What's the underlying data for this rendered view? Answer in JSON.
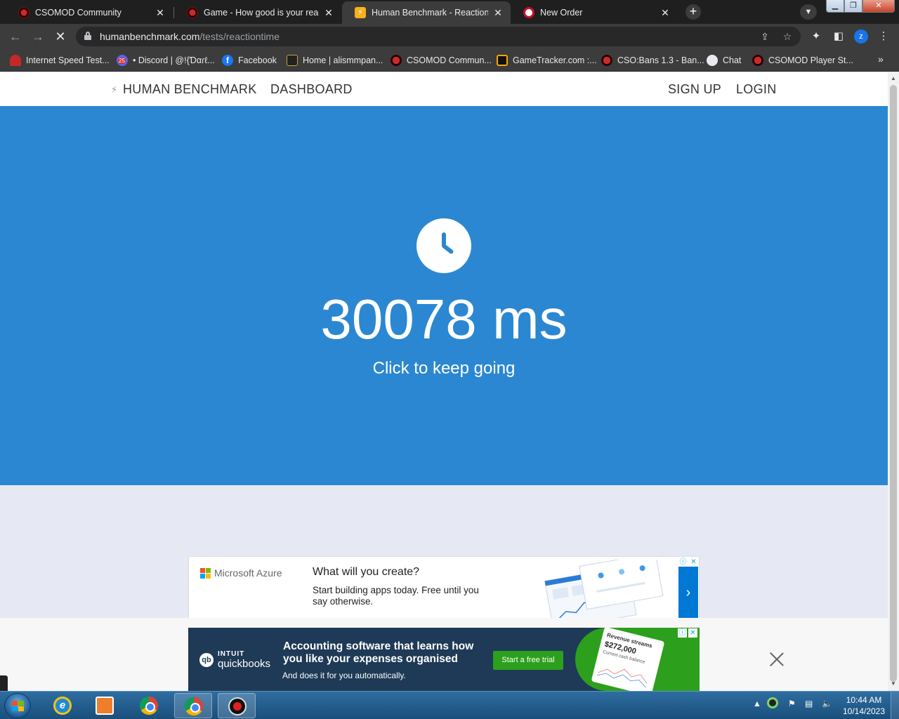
{
  "browser": {
    "tabs": [
      {
        "title": "CSOMOD Community",
        "active": false
      },
      {
        "title": "Game - How good is your reactio",
        "active": false
      },
      {
        "title": "Human Benchmark - Reaction Tir",
        "active": true
      },
      {
        "title": "New Order",
        "active": false
      }
    ],
    "url_host": "humanbenchmark.com",
    "url_path": "/tests/reactiontime",
    "profile_initial": "z",
    "bookmarks": [
      {
        "label": "Internet Speed Test...",
        "icon": "speedometer-icon"
      },
      {
        "label": "• Discord | @!{Ɗαɾℓ...",
        "icon": "discord-icon"
      },
      {
        "label": "Facebook",
        "icon": "facebook-icon"
      },
      {
        "label": "Home | alismmpan...",
        "icon": "home-site-icon"
      },
      {
        "label": "CSOMOD Commun...",
        "icon": "csomod-icon"
      },
      {
        "label": "GameTracker.com :...",
        "icon": "gametracker-icon"
      },
      {
        "label": "CSO:Bans 1.3 - Ban...",
        "icon": "csobans-icon"
      },
      {
        "label": "Chat",
        "icon": "chat-icon"
      },
      {
        "label": "CSOMOD Player St...",
        "icon": "csomod-icon"
      }
    ]
  },
  "site": {
    "brand": "HUMAN BENCHMARK",
    "nav": {
      "dashboard": "DASHBOARD",
      "signup": "SIGN UP",
      "login": "LOGIN"
    },
    "result": "30078 ms",
    "hint": "Click to keep going",
    "accent": "#2b87d1"
  },
  "ads": {
    "azure": {
      "brand": "Microsoft Azure",
      "headline": "What will you create?",
      "text": "Start building apps today. Free until you say otherwise."
    },
    "quickbooks": {
      "brand_top": "INTUIT",
      "brand": "quickbooks",
      "headline": "Accounting software that learns how you like your expenses organised",
      "text": "And does it for you automatically.",
      "cta": "Start a free trial",
      "card_title": "Revenue streams",
      "card_value": "$272,000",
      "card_sub": "Current cash balance"
    }
  },
  "taskbar": {
    "time": "10:44 AM",
    "date": "10/14/2023"
  }
}
